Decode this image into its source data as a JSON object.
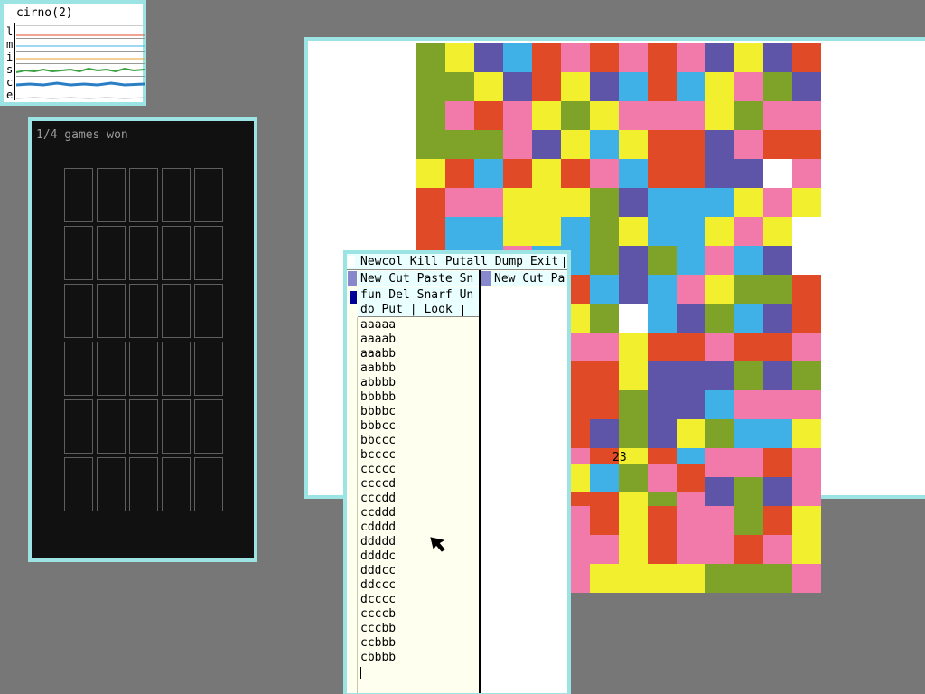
{
  "stats": {
    "title": "cirno(2)",
    "letters": [
      "l",
      "m",
      "i",
      "s",
      "c",
      "e"
    ]
  },
  "game": {
    "status": "1/4 games won"
  },
  "viewer": {
    "counter": "23",
    "palette": {
      "o": "#7fa329",
      "y": "#f2ef2e",
      "p": "#5e55a8",
      "b": "#3fb1e6",
      "r": "#e04a27",
      "k": "#f17aab",
      "w": "#ffffff"
    },
    "rows": [
      "oypbrkrkrkpypr",
      "ooyprypbrbykop",
      "okrkyoykkkyokk",
      "oookpybyrrpkrr",
      "yrbryrkbrrppwk",
      "rkkyyyopbbbyky",
      "rbbyyboybbykyw",
      "rbbkbbopobkbpw",
      "rrbbbrbpbkyoor",
      "rbbbyyowbpobpr",
      "rwbbbkkyrrkrrk",
      "rrbbbrrypppopo",
      "orkbprroppbkkk",
      "ooobrrpopyobby",
      "opbrkkryrbkkrk",
      "orbrkrryokpopk",
      "bbbrkkryrkkory",
      "bbybbkkyrkkrky",
      "bwwbbkyyyyoook"
    ],
    "extra_row": "ybokr"
  },
  "acme": {
    "row_tag": "Newcol Kill Putall Dump Exit",
    "col1_tag": "New Cut Paste Sn",
    "col2_tag": "New Cut Pa",
    "win_tag_line1": "fun Del Snarf Un",
    "win_tag_line2": "do Put | Look",
    "lines": [
      "aaaaa",
      "aaaab",
      "aaabb",
      "aabbb",
      "abbbb",
      "bbbbb",
      "bbbbc",
      "bbbcc",
      "bbccc",
      "bcccc",
      "ccccc",
      "ccccd",
      "cccdd",
      "ccddd",
      "cdddd",
      "ddddd",
      "ddddc",
      "dddcc",
      "ddccc",
      "dcccc",
      "ccccb",
      "cccbb",
      "ccbbb",
      "cbbbb"
    ]
  }
}
